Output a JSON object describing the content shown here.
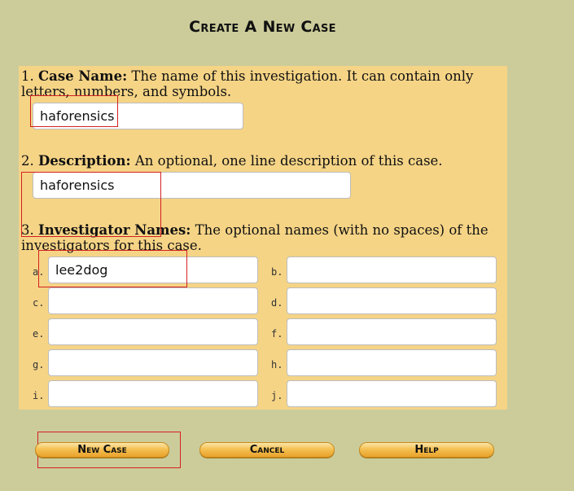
{
  "page": {
    "title": "Create A New Case"
  },
  "case_name": {
    "number": "1.",
    "label": "Case Name:",
    "description": " The name of this investigation. It can contain only letters, numbers, and symbols.",
    "value": "haforensics"
  },
  "description_field": {
    "number": "2.",
    "label": "Description:",
    "description": " An optional, one line description of this case.",
    "value": "haforensics"
  },
  "investigators": {
    "number": "3.",
    "label": "Investigator Names:",
    "description": " The optional names (with no spaces) of the investigators for this case.",
    "slots": [
      {
        "letter": "a.",
        "value": "lee2dog"
      },
      {
        "letter": "b.",
        "value": ""
      },
      {
        "letter": "c.",
        "value": ""
      },
      {
        "letter": "d.",
        "value": ""
      },
      {
        "letter": "e.",
        "value": ""
      },
      {
        "letter": "f.",
        "value": ""
      },
      {
        "letter": "g.",
        "value": ""
      },
      {
        "letter": "h.",
        "value": ""
      },
      {
        "letter": "i.",
        "value": ""
      },
      {
        "letter": "j.",
        "value": ""
      }
    ]
  },
  "buttons": {
    "new_case": "New Case",
    "cancel": "Cancel",
    "help": "Help"
  },
  "colors": {
    "background": "#cccc9b",
    "panel": "#f5d486",
    "button": "#f4c052",
    "highlight": "#d42020"
  }
}
